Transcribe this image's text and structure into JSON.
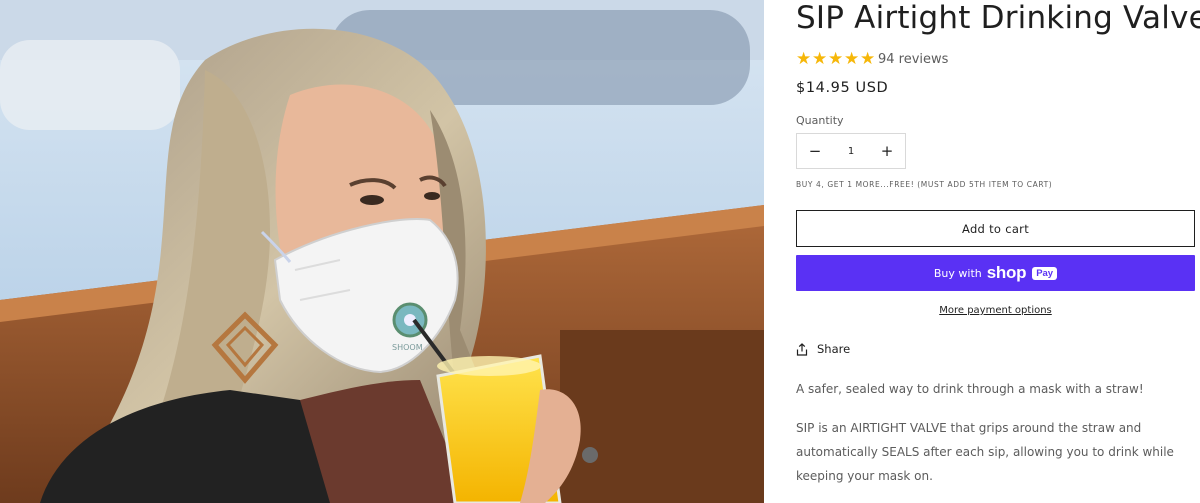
{
  "product": {
    "title": "SIP Airtight Drinking Valve",
    "rating_stars": 5,
    "stars": [
      "★",
      "★",
      "★",
      "★",
      "★"
    ],
    "reviews": "94 reviews",
    "price": "$14.95 USD"
  },
  "quantity": {
    "label": "Quantity",
    "value": "1",
    "minus": "−",
    "plus": "+"
  },
  "promo_text": "BUY 4, GET 1 MORE...FREE! (MUST ADD 5TH ITEM TO CART)",
  "buttons": {
    "add_to_cart": "Add to cart",
    "buy_with": "Buy with",
    "shop": "shop",
    "pay": "Pay",
    "more_payment": "More payment options",
    "share": "Share"
  },
  "description": {
    "tagline": "A safer, sealed way to drink through a mask with a straw!",
    "lines": [
      "SIP is an AIRTIGHT VALVE that grips around the straw and",
      "automatically SEALS after each sip, allowing you to drink while",
      "keeping your mask on."
    ]
  },
  "image": {
    "mask_logo_text": "SHOOM"
  },
  "colors": {
    "accent_star": "#f6b709",
    "shop_pay": "#5a31f4",
    "text": "#1f1f1f",
    "muted": "#5c5c5c"
  }
}
